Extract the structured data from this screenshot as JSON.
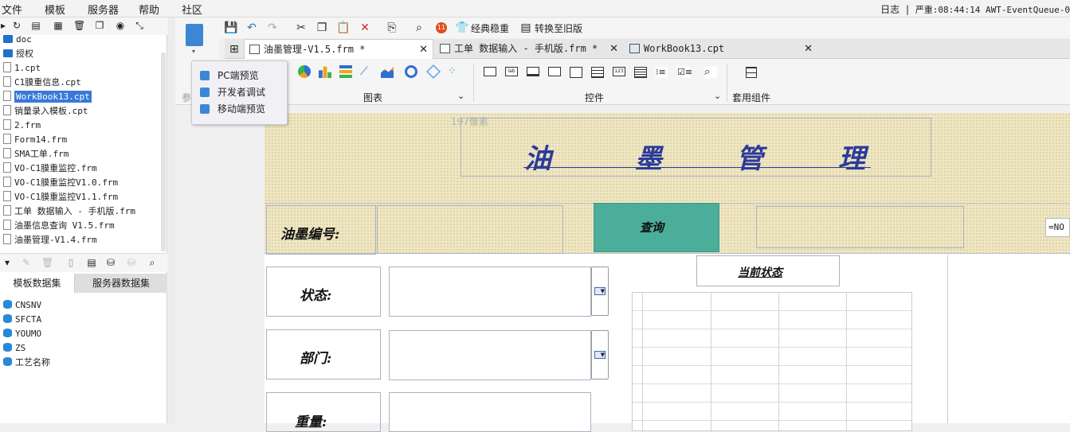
{
  "menubar": {
    "items": [
      "文件",
      "模板",
      "服务器",
      "帮助",
      "社区"
    ],
    "log_label": "日志",
    "status_text": "严重:08:44:14 AWT-EventQueue-0"
  },
  "left_panel": {
    "tree": [
      {
        "label": "doc",
        "type": "folder"
      },
      {
        "label": "授权",
        "type": "folder"
      },
      {
        "label": "1.cpt",
        "type": "file"
      },
      {
        "label": "C1膜重信息.cpt",
        "type": "file"
      },
      {
        "label": "WorkBook13.cpt",
        "type": "file",
        "selected": true
      },
      {
        "label": "销量录入模板.cpt",
        "type": "file"
      },
      {
        "label": "2.frm",
        "type": "file"
      },
      {
        "label": "Form14.frm",
        "type": "file"
      },
      {
        "label": "SMA工单.frm",
        "type": "file"
      },
      {
        "label": "VO-C1膜重监控.frm",
        "type": "file"
      },
      {
        "label": "VO-C1膜重监控V1.0.frm",
        "type": "file"
      },
      {
        "label": "VO-C1膜重监控V1.1.frm",
        "type": "file"
      },
      {
        "label": "工单 数据输入 - 手机版.frm",
        "type": "file"
      },
      {
        "label": "油墨信息查询 V1.5.frm",
        "type": "file"
      },
      {
        "label": "油墨管理-V1.4.frm",
        "type": "file"
      }
    ],
    "dataset_tabs": [
      "模板数据集",
      "服务器数据集"
    ],
    "datasets": [
      "CNSNV",
      "SFCTA",
      "YOUMO",
      "ZS",
      "工艺名称"
    ]
  },
  "toolbar": {
    "notification_count": "11",
    "classic_label": "经典稳重",
    "revert_label": "转换至旧版"
  },
  "tabs": [
    {
      "label": "油墨管理-V1.5.frm *",
      "active": true
    },
    {
      "label": "工单 数据输入 - 手机版.frm *",
      "active": false
    },
    {
      "label": "WorkBook13.cpt",
      "active": false
    }
  ],
  "ribbon": {
    "left_partial_label": "参",
    "chart_group_label": "图表",
    "control_group_label": "控件",
    "template_group_label": "套用组件"
  },
  "preview_popup": {
    "items": [
      "PC端预览",
      "开发者调试",
      "移动端预览"
    ]
  },
  "form": {
    "width_hint": "197像素",
    "title_chars": [
      "油",
      "墨",
      "管",
      "理"
    ],
    "ink_no_label": "油墨编号:",
    "query_button": "查询",
    "formula_text": "=NO",
    "status_label": "状态:",
    "dept_label": "部门:",
    "weight_label": "重量:",
    "current_status_label": "当前状态"
  },
  "colors": {
    "query_button_bg": "#4aae9b",
    "title_color": "#2a3b9b",
    "selection": "#3879d9"
  }
}
